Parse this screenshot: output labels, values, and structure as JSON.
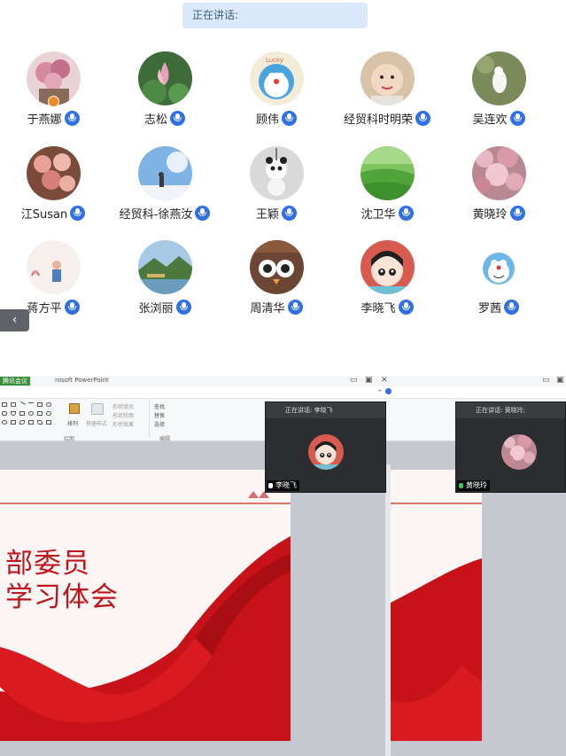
{
  "speaking_bar": {
    "label": "正在讲话:"
  },
  "participants": [
    {
      "name": "于燕娜",
      "avatar": "pink-flowers",
      "host": true
    },
    {
      "name": "志松",
      "avatar": "lotus"
    },
    {
      "name": "顾伟",
      "avatar": "doraemon-lucky"
    },
    {
      "name": "经贸科时明荣",
      "avatar": "baby"
    },
    {
      "name": "吴连欢",
      "avatar": "white-dog"
    },
    {
      "name": "江Susan",
      "avatar": "roses"
    },
    {
      "name": "经贸科-徐燕汝",
      "avatar": "sky-girl"
    },
    {
      "name": "王颖",
      "avatar": "panda-toy"
    },
    {
      "name": "沈卫华",
      "avatar": "green-field"
    },
    {
      "name": "黄晓玲",
      "avatar": "cherry-blossom"
    },
    {
      "name": "蒋方平",
      "avatar": "girl-sketch"
    },
    {
      "name": "张浏丽",
      "avatar": "mountain-lake"
    },
    {
      "name": "周清华",
      "avatar": "owl-cartoon"
    },
    {
      "name": "李晓飞",
      "avatar": "cartoon-girl"
    },
    {
      "name": "罗茜",
      "avatar": "doraemon"
    }
  ],
  "collapse_icon": "chevron-left-icon",
  "powerpoint": {
    "meeting_tag": "腾讯会议",
    "window_title": "rosoft PowerPoint",
    "ribbon": {
      "arrange": "排列",
      "quick_styles": "快速样式",
      "shape_fill": "形状填充",
      "shape_outline": "形状轮廓",
      "shape_effects": "形状效果",
      "find": "查找",
      "replace": "替换",
      "select": "选择",
      "group_drawing": "绘图",
      "group_editing": "编辑"
    },
    "slide_title_line1": "部委员",
    "slide_title_line2": "学习体会"
  },
  "video_windows": [
    {
      "header": "正在讲话: 李晓飞",
      "name": "李晓飞",
      "avatar": "cartoon-girl",
      "mic_color": "#ffffff"
    },
    {
      "header": "正在讲话: 黄晓玲;",
      "name": "黄晓玲",
      "avatar": "cherry-blossom",
      "mic_color": "#3cc05a"
    }
  ],
  "colors": {
    "accent": "#2f6fe8",
    "speaking_bg": "#dce8fb",
    "slide_red": "#c0131b"
  }
}
